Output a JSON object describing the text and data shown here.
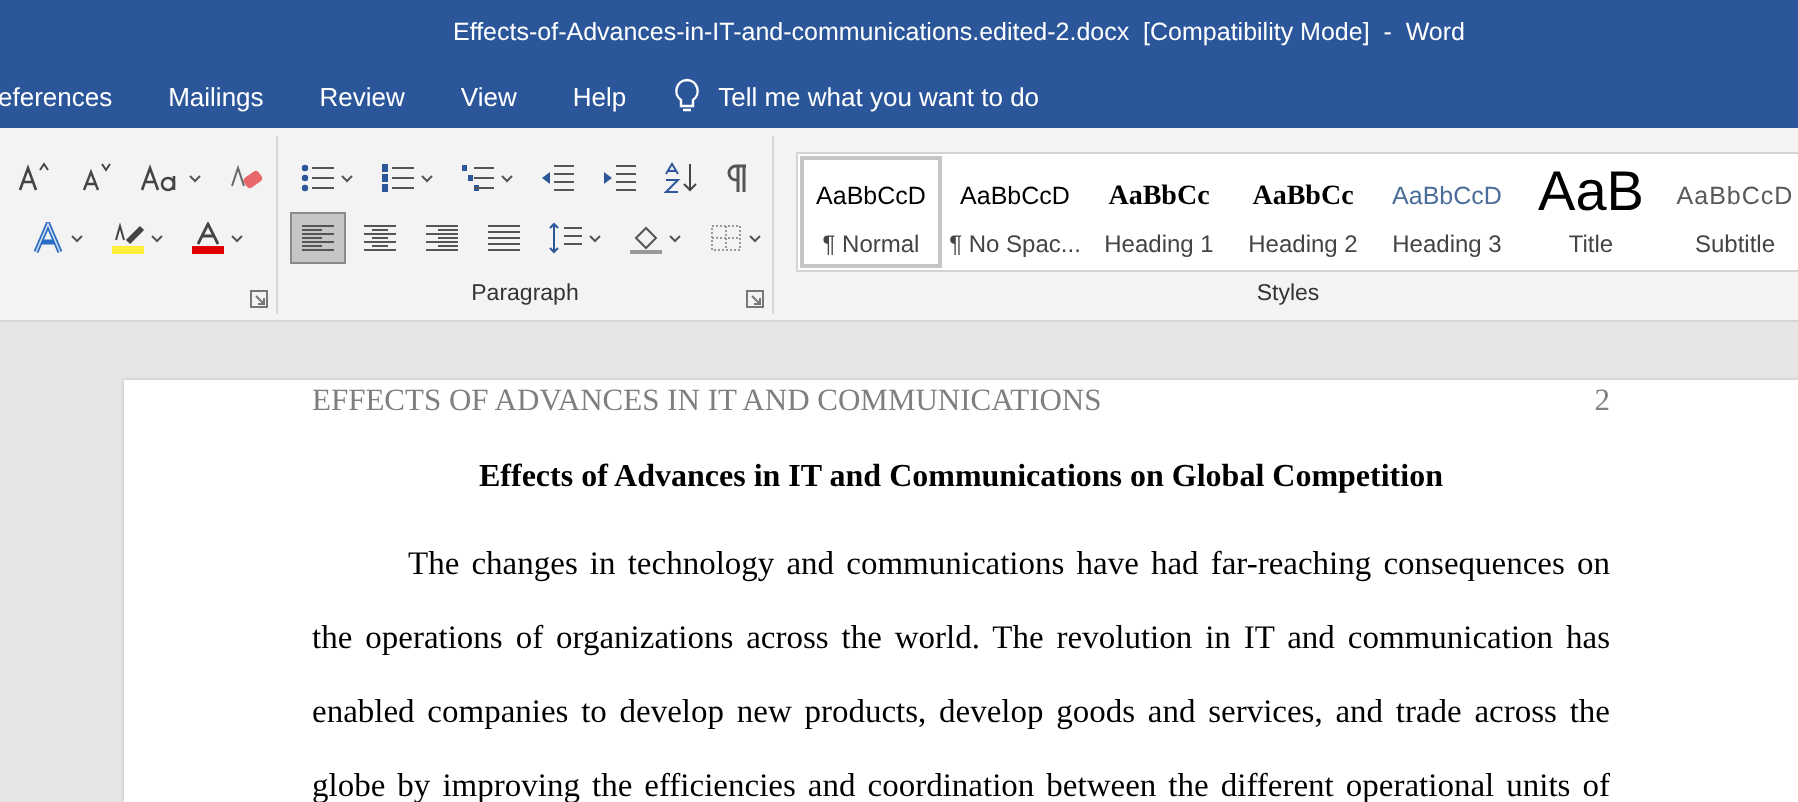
{
  "window": {
    "title": "Effects-of-Advances-in-IT-and-communications.edited-2.docx  [Compatibility Mode]  -  Word"
  },
  "tabs": [
    {
      "label": "eferences",
      "selected": false
    },
    {
      "label": "Mailings",
      "selected": false
    },
    {
      "label": "Review",
      "selected": false
    },
    {
      "label": "View",
      "selected": false
    },
    {
      "label": "Help",
      "selected": false
    }
  ],
  "tell_me": {
    "placeholder": "Tell me what you want to do"
  },
  "font_group": {
    "row_1": [
      {
        "kind": "grow",
        "selected": false,
        "menu": false
      },
      {
        "kind": "shrink",
        "selected": false,
        "menu": false
      },
      {
        "kind": "case",
        "selected": false,
        "menu": true
      },
      {
        "kind": "clear",
        "selected": false,
        "menu": false
      }
    ],
    "row_2": [
      {
        "kind": "effects",
        "selected": false,
        "menu": true
      },
      {
        "kind": "highlight",
        "selected": false,
        "menu": true
      },
      {
        "kind": "fontcolor",
        "selected": false,
        "menu": true
      }
    ]
  },
  "paragraph_group": {
    "label": "Paragraph",
    "row_1": [
      {
        "kind": "bullets",
        "selected": false,
        "menu": true
      },
      {
        "kind": "numbering",
        "selected": false,
        "menu": true
      },
      {
        "kind": "multilevel",
        "selected": false,
        "menu": true
      },
      {
        "kind": "outdent",
        "selected": false,
        "menu": false
      },
      {
        "kind": "indent",
        "selected": false,
        "menu": false
      },
      {
        "kind": "sort",
        "selected": false,
        "menu": false
      },
      {
        "kind": "pilcrow",
        "selected": false,
        "menu": false
      }
    ],
    "row_2": [
      {
        "kind": "left",
        "selected": true,
        "menu": false
      },
      {
        "kind": "center",
        "selected": false,
        "menu": false
      },
      {
        "kind": "right",
        "selected": false,
        "menu": false
      },
      {
        "kind": "justify",
        "selected": false,
        "menu": false
      },
      {
        "kind": "spacing",
        "selected": false,
        "menu": true
      },
      {
        "kind": "shading",
        "selected": false,
        "menu": true
      },
      {
        "kind": "borders",
        "selected": false,
        "menu": true
      }
    ]
  },
  "styles_group": {
    "label": "Styles",
    "items": [
      {
        "kind": "normal",
        "preview": "AaBbCcD",
        "label": "¶ Normal",
        "selected": true
      },
      {
        "kind": "normal",
        "preview": "AaBbCcD",
        "label": "¶ No Spac...",
        "selected": false
      },
      {
        "kind": "heading",
        "preview": "AaBbCc",
        "label": "Heading 1",
        "selected": false
      },
      {
        "kind": "heading",
        "preview": "AaBbCc",
        "label": "Heading 2",
        "selected": false
      },
      {
        "kind": "heading3",
        "preview": "AaBbCcD",
        "label": "Heading 3",
        "selected": false
      },
      {
        "kind": "title",
        "preview": "AaB",
        "label": "Title",
        "selected": false
      },
      {
        "kind": "subtitle",
        "preview": "AaBbCcD",
        "label": "Subtitle",
        "selected": false
      }
    ]
  },
  "document": {
    "header": "EFFECTS OF ADVANCES IN IT AND COMMUNICATIONS",
    "page_number": "2",
    "heading": "Effects of Advances in IT and Communications on Global Competition",
    "paragraph": "The changes in technology and communications have had far-reaching consequences on the operations of organizations across the world. The revolution in IT and communication has enabled companies to develop new products, develop goods and services, and trade across the globe by improving the efficiencies and coordination between the different operational units of"
  }
}
